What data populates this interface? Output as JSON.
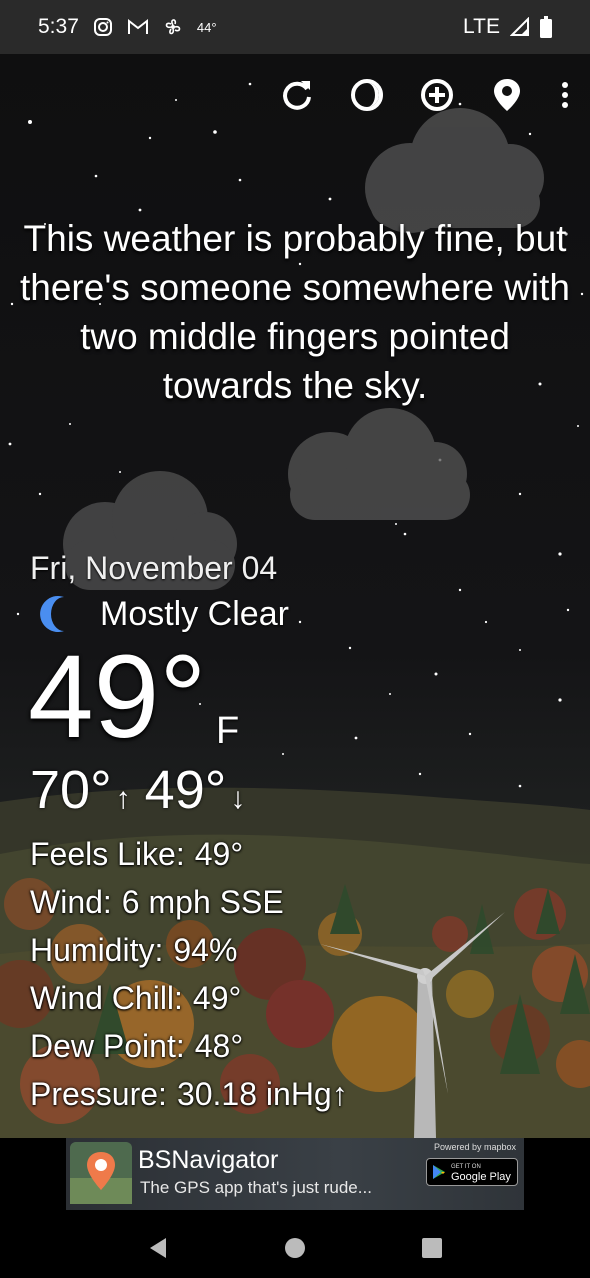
{
  "status_bar": {
    "time": "5:37",
    "temp": "44°",
    "network": "LTE",
    "icons": [
      "instagram-icon",
      "gmail-icon",
      "fan-icon",
      "signal-icon",
      "battery-icon"
    ]
  },
  "toolbar": {
    "icons": [
      "refresh-icon",
      "theme-icon",
      "add-location-icon",
      "location-pin-icon",
      "more-vert-icon"
    ]
  },
  "quote": "This weather is probably fine, but there's someone somewhere with two middle fingers pointed towards the sky.",
  "weather": {
    "date": "Fri, November 04",
    "condition": "Mostly Clear",
    "condition_icon": "moon-icon",
    "temperature": "49°",
    "unit": "F",
    "high": "70°",
    "low": "49°",
    "details": [
      {
        "label": "Feels Like:",
        "value": "49°"
      },
      {
        "label": "Wind:",
        "value": "6 mph SSE"
      },
      {
        "label": "Humidity:",
        "value": "94%"
      },
      {
        "label": "Wind Chill:",
        "value": "49°"
      },
      {
        "label": "Dew Point:",
        "value": "48°"
      },
      {
        "label": "Pressure:",
        "value": "30.18 inHg↑"
      }
    ]
  },
  "ad": {
    "title": "BSNavigator",
    "subtitle": "The GPS app that's just rude...",
    "powered_by": "Powered by mapbox",
    "store_small": "GET IT ON",
    "store_big": "Google Play"
  },
  "colors": {
    "moon": "#4a8ef0",
    "status_bar": "#2a2a2a"
  }
}
